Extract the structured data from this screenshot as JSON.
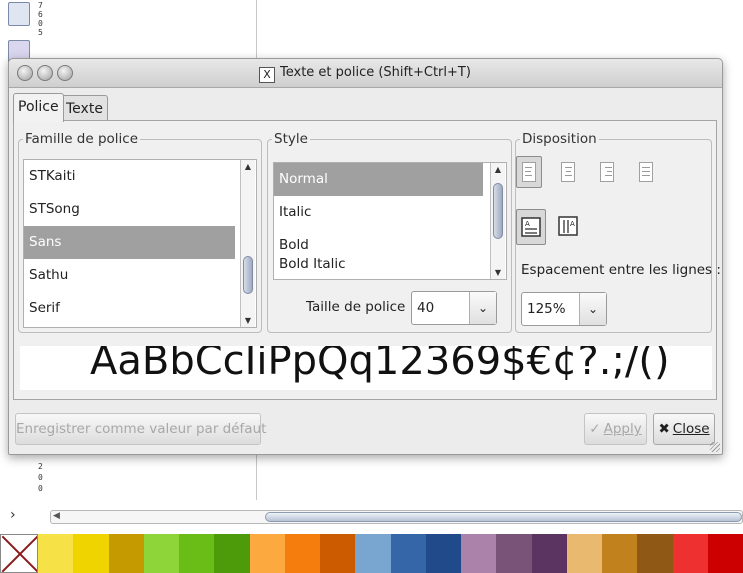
{
  "background": {
    "ruler_labels_top": [
      "7",
      "6",
      "0",
      "5"
    ],
    "ruler_labels_bottom": [
      "2",
      "0",
      "0"
    ],
    "chevron": "›",
    "palette_colors": [
      "#f6e247",
      "#f0d400",
      "#c49a00",
      "#8ed53a",
      "#6abd16",
      "#4d9a0b",
      "#fcaa40",
      "#f47d0d",
      "#cc5b00",
      "#79a6d1",
      "#3567a8",
      "#214a8a",
      "#ab82aa",
      "#795478",
      "#5b3462",
      "#e8b96e",
      "#c1811d",
      "#8f5915",
      "#ef3030",
      "#cc0000"
    ]
  },
  "dialog": {
    "title": "Texte et police (Shift+Ctrl+T)",
    "title_icon": "X",
    "tabs": [
      {
        "label": "Police",
        "active": true
      },
      {
        "label": "Texte",
        "active": false
      }
    ],
    "font_family": {
      "legend": "Famille de police",
      "items": [
        {
          "label": "STKaiti",
          "selected": false
        },
        {
          "label": "STSong",
          "selected": false
        },
        {
          "label": "Sans",
          "selected": true
        },
        {
          "label": "Sathu",
          "selected": false
        },
        {
          "label": "Serif",
          "selected": false
        }
      ]
    },
    "style": {
      "legend": "Style",
      "items": [
        {
          "label": "Normal",
          "selected": true
        },
        {
          "label": "Italic",
          "selected": false
        },
        {
          "label": "Bold",
          "selected": false
        }
      ],
      "partial_item": "Bold Italic",
      "size_label": "Taille de police :",
      "size_value": "40"
    },
    "layout": {
      "legend": "Disposition",
      "alignments": [
        "align-left",
        "align-center",
        "align-right",
        "align-justify"
      ],
      "active_alignment": "align-left",
      "directions": [
        "horizontal",
        "vertical"
      ],
      "active_direction": "horizontal",
      "spacing_label": "Espacement entre les lignes :",
      "spacing_value": "125%"
    },
    "preview_text": "AaBbCcIiPpQq12369$€¢?.;/()",
    "buttons": {
      "set_default": "Enregistrer comme valeur par défaut",
      "apply": "Apply",
      "close": "Close"
    }
  }
}
